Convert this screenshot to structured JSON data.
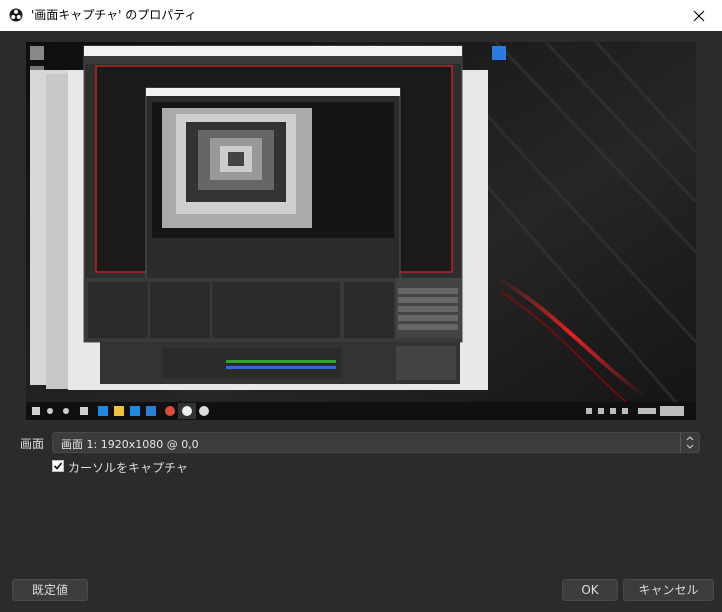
{
  "window": {
    "title": "'画面キャプチャ' のプロパティ",
    "app_icon": "obs-icon",
    "close_icon": "close-icon"
  },
  "preview": {
    "description_icon": "screen-capture-preview"
  },
  "form": {
    "screen_label": "画面",
    "screen_value": "画面 1: 1920x1080 @ 0,0",
    "capture_cursor_label": "カーソルをキャプチャ",
    "capture_cursor_checked": true
  },
  "buttons": {
    "defaults": "既定値",
    "ok": "OK",
    "cancel": "キャンセル"
  }
}
